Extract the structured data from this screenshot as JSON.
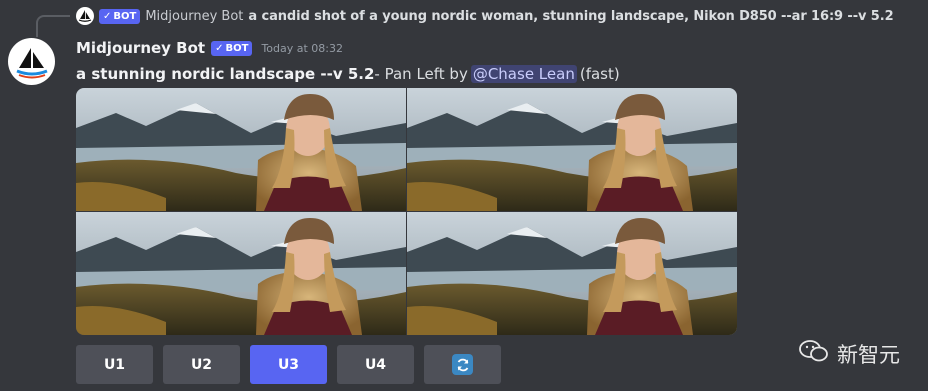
{
  "reply": {
    "bot_tag": "BOT",
    "author": "Midjourney Bot",
    "text": "a candid shot of a young nordic woman, stunning landscape, Nikon D850 --ar 16:9 --v 5.2"
  },
  "message": {
    "author": "Midjourney Bot",
    "bot_tag": "BOT",
    "timestamp": "Today at 08:32",
    "prompt": "a stunning nordic landscape --v 5.2",
    "action": " - Pan Left by",
    "mention": "@Chase Lean",
    "speed": "(fast)"
  },
  "image_grid": {
    "alt": "2x2 grid of generated images: young woman in knit beanie and maroon jacket in a nordic fjord landscape"
  },
  "buttons": [
    {
      "label": "U1",
      "selected": false
    },
    {
      "label": "U2",
      "selected": false
    },
    {
      "label": "U3",
      "selected": true
    },
    {
      "label": "U4",
      "selected": false
    },
    {
      "icon": "refresh-icon"
    }
  ],
  "watermark": {
    "text": "新智元",
    "icon": "wechat-icon"
  },
  "colors": {
    "background": "#35373c",
    "blurple": "#5865f2",
    "button": "#4e5058"
  }
}
